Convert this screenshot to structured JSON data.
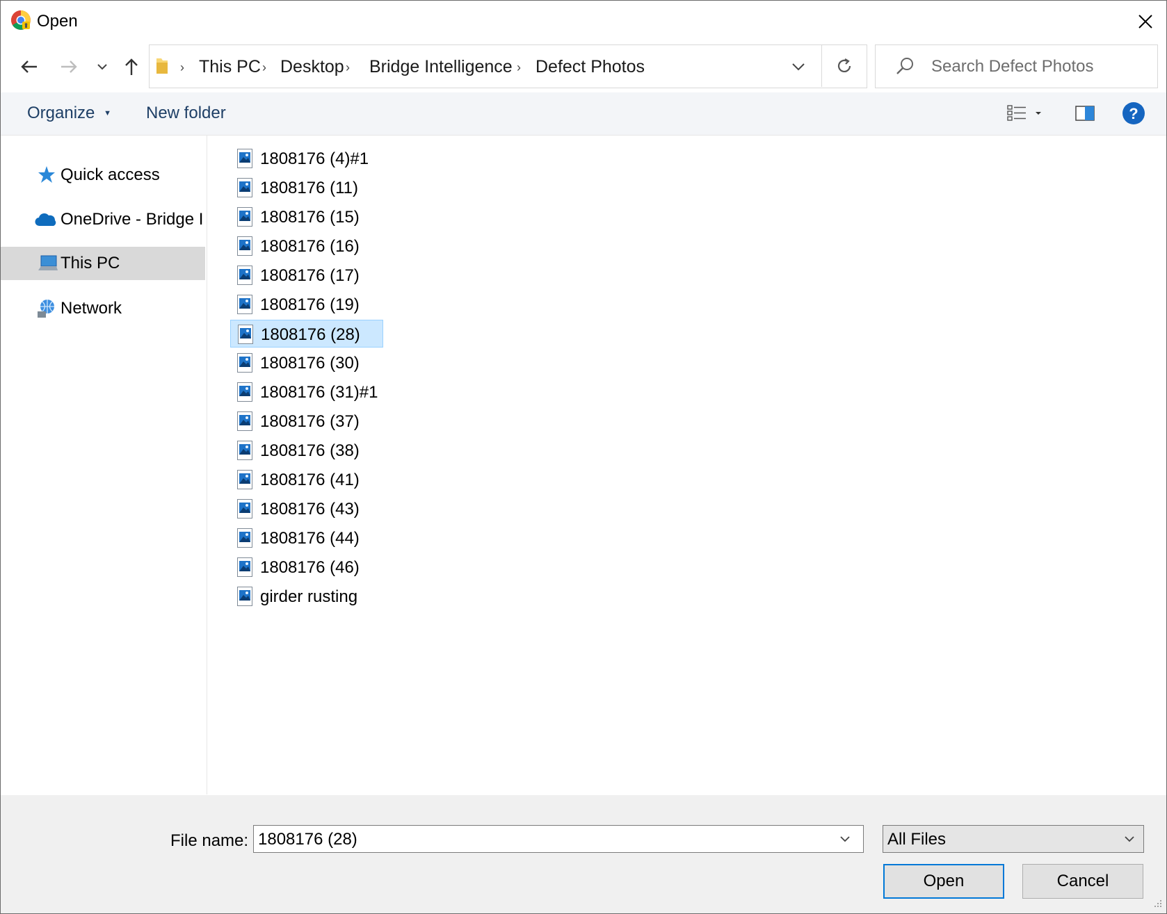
{
  "window": {
    "title": "Open",
    "app_icon": "chrome-icon",
    "close_icon": "close-icon"
  },
  "nav": {
    "back_icon": "arrow-left-icon",
    "forward_icon": "arrow-right-icon",
    "recent_icon": "chevron-down-icon",
    "up_icon": "arrow-up-icon"
  },
  "address": {
    "folder_icon": "folder-icon",
    "crumbs": [
      "This PC",
      "Desktop",
      "Bridge Intelligence",
      "Defect Photos"
    ],
    "dropdown_icon": "chevron-down-icon",
    "refresh_icon": "refresh-icon"
  },
  "search": {
    "placeholder": "Search Defect Photos",
    "icon": "search-icon"
  },
  "toolbar": {
    "organize_label": "Organize",
    "new_folder_label": "New folder",
    "view_icon": "view-options-icon",
    "preview_pane_icon": "preview-pane-icon",
    "help_icon": "help-icon"
  },
  "sidebar": {
    "items": [
      {
        "label": "Quick access",
        "icon": "star-icon"
      },
      {
        "label": "OneDrive - Bridge I",
        "icon": "cloud-icon"
      },
      {
        "label": "This PC",
        "icon": "computer-icon",
        "selected": true
      },
      {
        "label": "Network",
        "icon": "network-icon"
      }
    ]
  },
  "files": [
    {
      "name": "1808176 (4)#1"
    },
    {
      "name": "1808176 (11)"
    },
    {
      "name": "1808176 (15)"
    },
    {
      "name": "1808176 (16)"
    },
    {
      "name": "1808176 (17)"
    },
    {
      "name": "1808176 (19)"
    },
    {
      "name": "1808176 (28)",
      "selected": true
    },
    {
      "name": "1808176 (30)"
    },
    {
      "name": "1808176 (31)#1"
    },
    {
      "name": "1808176 (37)"
    },
    {
      "name": "1808176 (38)"
    },
    {
      "name": "1808176 (41)"
    },
    {
      "name": "1808176 (43)"
    },
    {
      "name": "1808176 (44)"
    },
    {
      "name": "1808176 (46)"
    },
    {
      "name": "girder rusting"
    }
  ],
  "footer": {
    "file_name_label": "File name:",
    "file_name_value": "1808176 (28)",
    "file_type_value": "All Files",
    "open_label": "Open",
    "cancel_label": "Cancel"
  },
  "colors": {
    "selection_bg": "#cce8ff",
    "selection_border": "#99d1ff",
    "toolbar_bg": "#f3f5f8",
    "footer_bg": "#f0f0f0",
    "sidebar_selected_bg": "#d9d9d9",
    "accent": "#0078d7",
    "link_text": "#1e3f66"
  }
}
